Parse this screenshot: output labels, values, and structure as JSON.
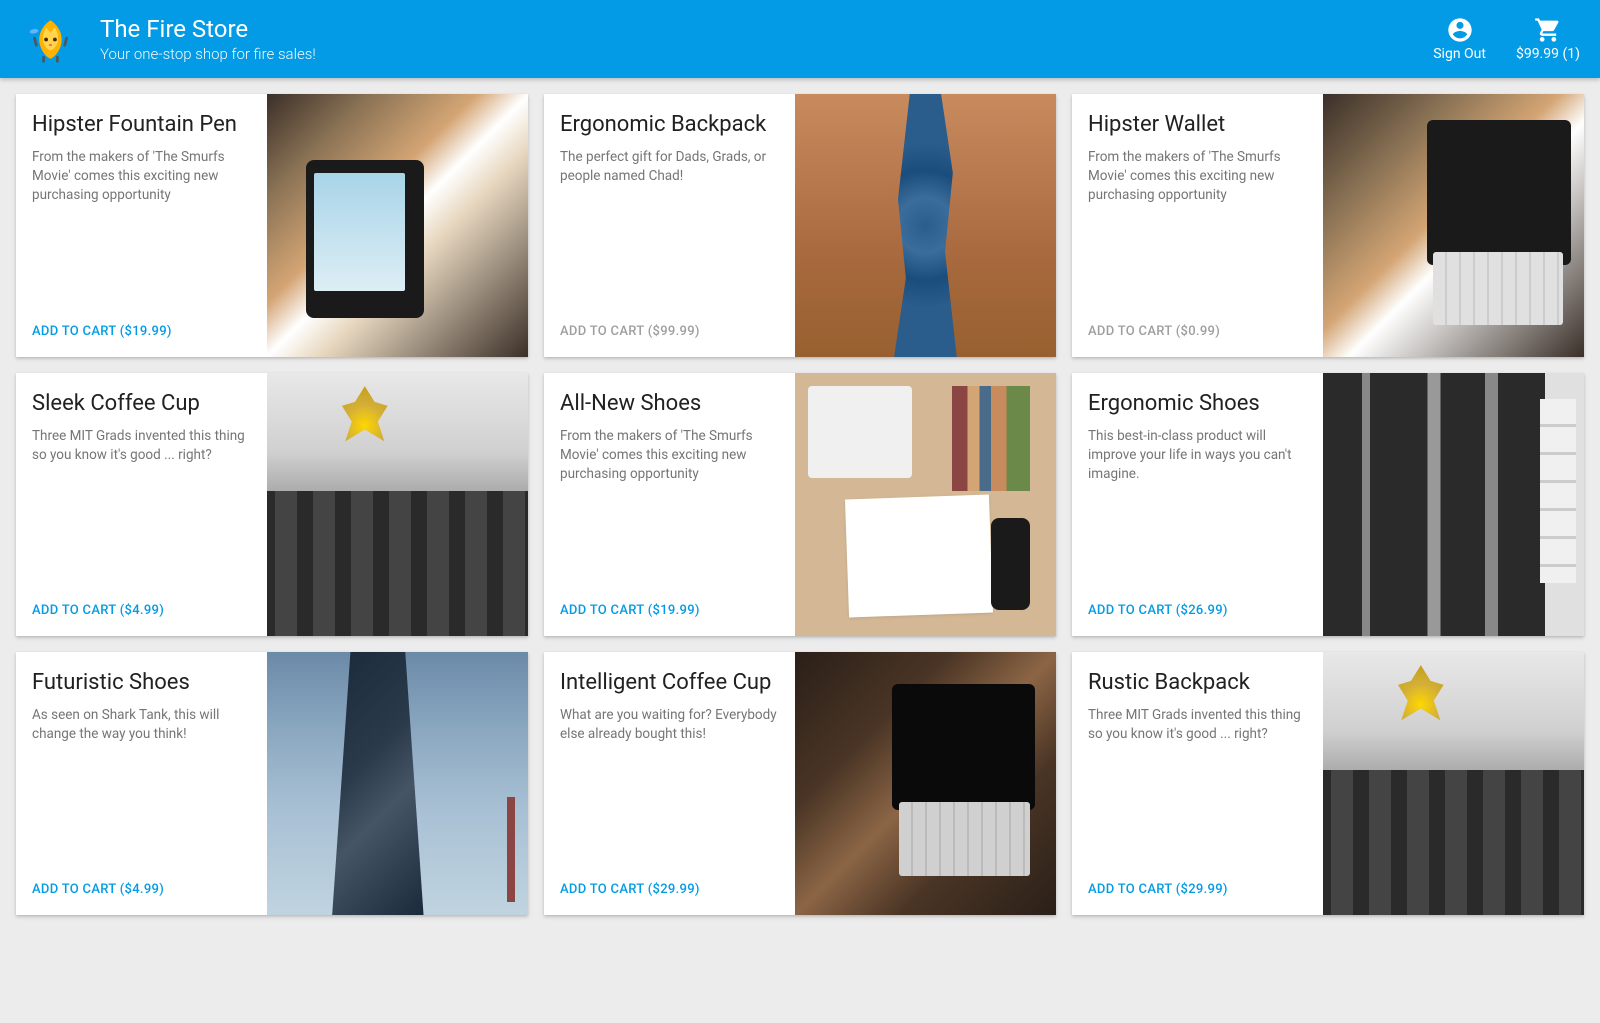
{
  "header": {
    "title": "The Fire Store",
    "subtitle": "Your one-stop shop for fire sales!",
    "signOut": "Sign Out",
    "cart": "$99.99 (1)"
  },
  "products": [
    {
      "title": "Hipster Fountain Pen",
      "desc": "From the makers of 'The Smurfs Movie' comes this exciting new purchasing opportunity",
      "action": "ADD TO CART ($19.99)",
      "enabled": true,
      "imageClass": "img-tablet-hand"
    },
    {
      "title": "Ergonomic Backpack",
      "desc": "The perfect gift for Dads, Grads, or people named Chad!",
      "action": "ADD TO CART ($99.99)",
      "enabled": false,
      "imageClass": "img-canyon"
    },
    {
      "title": "Hipster Wallet",
      "desc": "From the makers of 'The Smurfs Movie' comes this exciting new purchasing opportunity",
      "action": "ADD TO CART ($0.99)",
      "enabled": false,
      "imageClass": "img-tablet-keyboard"
    },
    {
      "title": "Sleek Coffee Cup",
      "desc": "Three MIT Grads invented this thing so you know it's good ... right?",
      "action": "ADD TO CART ($4.99)",
      "enabled": true,
      "imageClass": "img-lamps"
    },
    {
      "title": "All-New Shoes",
      "desc": "From the makers of 'The Smurfs Movie' comes this exciting new purchasing opportunity",
      "action": "ADD TO CART ($19.99)",
      "enabled": true,
      "imageClass": "img-desk"
    },
    {
      "title": "Ergonomic Shoes",
      "desc": "This best-in-class product will improve your life in ways you can't imagine.",
      "action": "ADD TO CART ($26.99)",
      "enabled": true,
      "imageClass": "img-building-bw"
    },
    {
      "title": "Futuristic Shoes",
      "desc": "As seen on Shark Tank, this will change the way you think!",
      "action": "ADD TO CART ($4.99)",
      "enabled": true,
      "imageClass": "img-skyscraper"
    },
    {
      "title": "Intelligent Coffee Cup",
      "desc": "What are you waiting for? Everybody else already bought this!",
      "action": "ADD TO CART ($29.99)",
      "enabled": true,
      "imageClass": "img-tablet-dark"
    },
    {
      "title": "Rustic Backpack",
      "desc": "Three MIT Grads invented this thing so you know it's good ... right?",
      "action": "ADD TO CART ($29.99)",
      "enabled": true,
      "imageClass": "img-lamps"
    }
  ]
}
